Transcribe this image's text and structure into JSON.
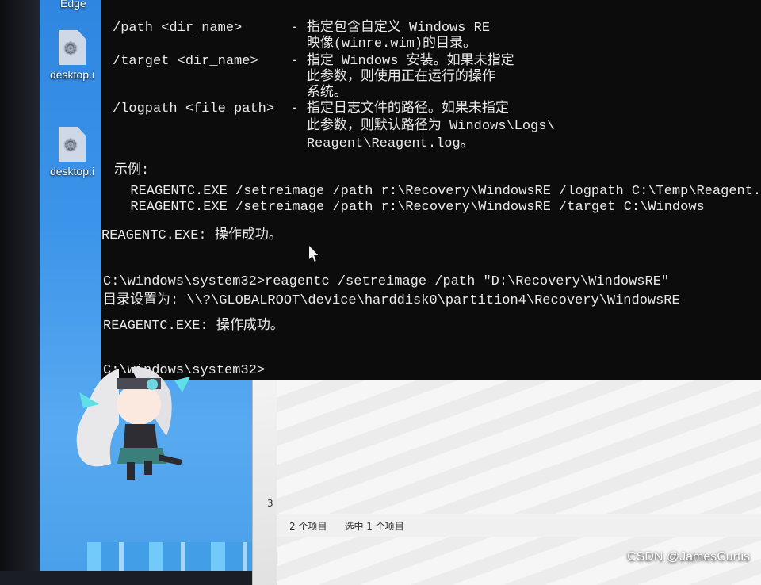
{
  "desktop": {
    "edge_label": "Edge",
    "icons": [
      {
        "label": "desktop.i"
      },
      {
        "label": "desktop.i"
      }
    ]
  },
  "terminal": {
    "lines": [
      "/path <dir_name>      - 指定包含自定义 Windows RE",
      "                        映像(winre.wim)的目录。",
      "/target <dir_name>    - 指定 Windows 安装。如果未指定",
      "                        此参数，则使用正在运行的操作",
      "                        系统。",
      "/logpath <file_path>  - 指定日志文件的路径。如果未指定",
      "                        此参数，则默认路径为 Windows\\Logs\\",
      "                        Reagent\\Reagent.log。",
      "示例:",
      "  REAGENTC.EXE /setreimage /path r:\\Recovery\\WindowsRE /logpath C:\\Temp\\Reagent.log",
      "  REAGENTC.EXE /setreimage /path r:\\Recovery\\WindowsRE /target C:\\Windows",
      "REAGENTC.EXE: 操作成功。",
      "C:\\windows\\system32>reagentc /setreimage /path \"D:\\Recovery\\WindowsRE\"",
      "目录设置为: \\\\?\\GLOBALROOT\\device\\harddisk0\\partition4\\Recovery\\WindowsRE",
      "REAGENTC.EXE: 操作成功。",
      "C:\\windows\\system32>"
    ]
  },
  "explorer": {
    "left_number": "3",
    "item_count": "2 个项目",
    "selected": "选中 1 个项目"
  },
  "watermark": "CSDN @JamesCurtis"
}
